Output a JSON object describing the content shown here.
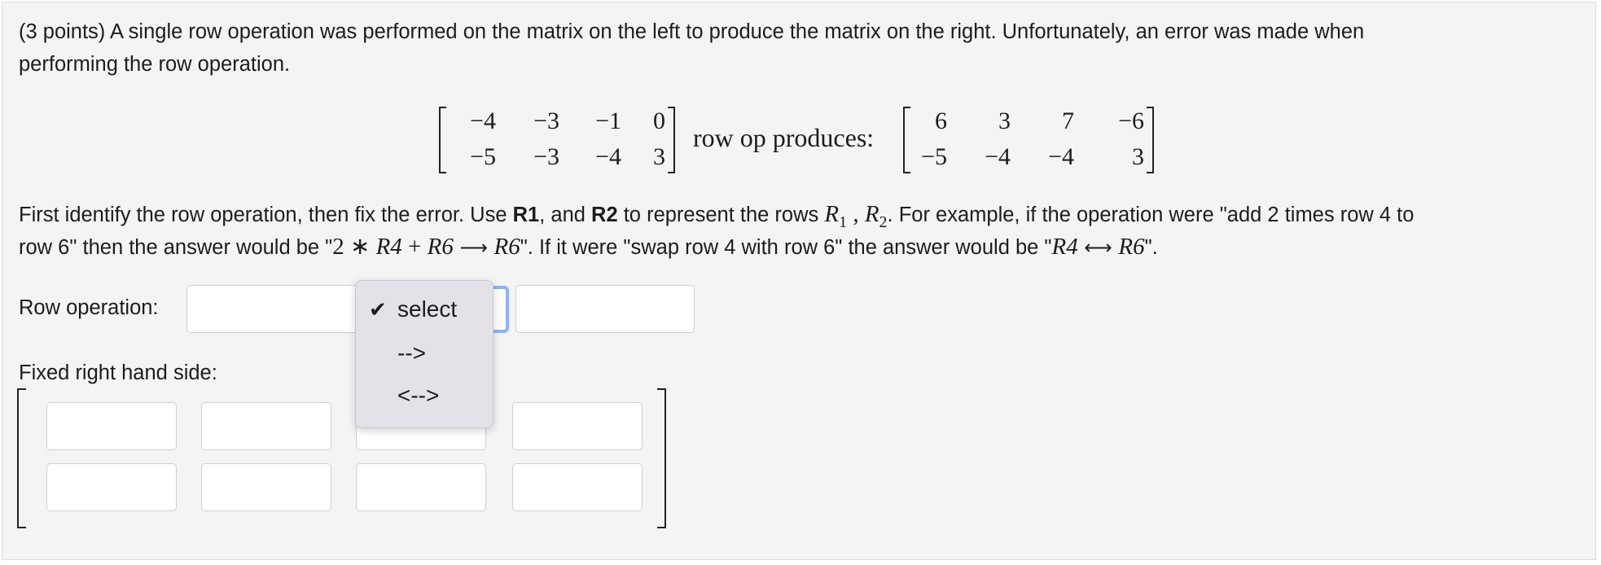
{
  "question": {
    "intro_line1": "(3 points) A single row operation was performed on the matrix on the left to produce the matrix on the right. Unfortunately, an error was made when",
    "intro_line2": "performing the row operation.",
    "left_matrix": [
      [
        "−4",
        "−3",
        "−1",
        "0"
      ],
      [
        "−5",
        "−3",
        "−4",
        "3"
      ]
    ],
    "produces_text": "row op produces:",
    "right_matrix": [
      [
        "6",
        "3",
        "7",
        "−6"
      ],
      [
        "−5",
        "−4",
        "−4",
        "3"
      ]
    ],
    "instr": {
      "p1": "First identify the row operation, then fix the error. Use ",
      "r1": "R1",
      "p2": ", and ",
      "r2": "R2",
      "p3": " to represent the rows ",
      "R": "R",
      "sub1": "1",
      "comma": " , ",
      "sub2": "2",
      "p4": ". For example, if the operation were \"add 2 times row 4 to",
      "p5": "row 6\" then the answer would be \"",
      "ex1_a": "2 ∗ ",
      "ex1_b": "R4",
      "ex1_c": " + ",
      "ex1_d": "R6",
      "ex1_arrow": " ⟶ ",
      "ex1_e": "R6",
      "p6": "\". If it were \"swap row 4 with row 6\" the answer would be \"",
      "ex2_a": "R4",
      "ex2_arrow": " ⟷ ",
      "ex2_b": "R6",
      "p7": "\"."
    }
  },
  "form": {
    "row_operation_label": "Row operation:",
    "fixed_rhs_label": "Fixed right hand side:"
  },
  "dropdown": {
    "check_mark": "✔",
    "options": [
      "select",
      "-->",
      "<-->"
    ],
    "selected_index": 0
  }
}
